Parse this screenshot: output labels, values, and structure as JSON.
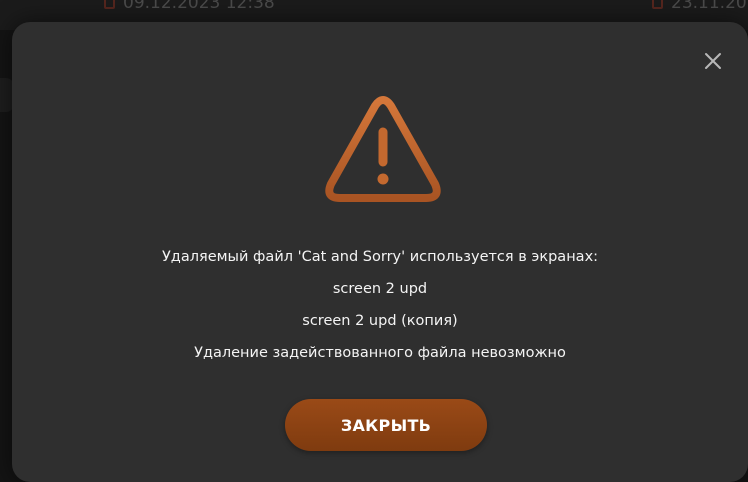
{
  "background": {
    "left_date": "09.12.2023 12:38",
    "right_date": "23.11.20"
  },
  "dialog": {
    "icon": "warning-triangle-icon",
    "close_icon": "close-x-icon",
    "message_lines": [
      "Удаляемый файл 'Cat and Sorry' используется в экранах:",
      "screen 2 upd",
      "screen 2 upd (копия)",
      "Удаление задействованного файла невозможно"
    ],
    "close_button_label": "ЗАКРЫТЬ"
  },
  "colors": {
    "accent": "#c0662b",
    "button": "#8a4213",
    "modal_bg": "#2f2f2f"
  }
}
